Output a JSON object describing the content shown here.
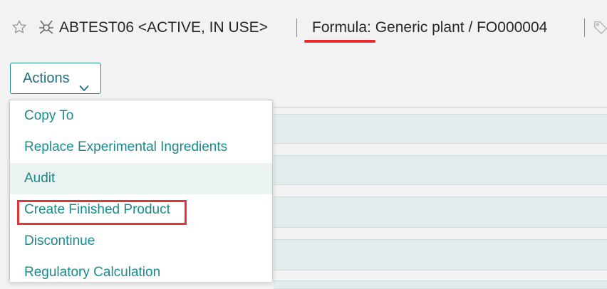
{
  "header": {
    "record_title": "ABTEST06 <ACTIVE, IN USE>",
    "formula_key": "Formula",
    "formula_value": ": Generic plant / FO000004",
    "icons": [
      "star-icon",
      "node-icon",
      "tag-icon"
    ]
  },
  "actions": {
    "label": "Actions",
    "icon": "chevron-down-icon"
  },
  "menu": {
    "items": [
      {
        "label": "Copy To"
      },
      {
        "label": "Replace Experimental Ingredients"
      },
      {
        "label": "Audit",
        "highlighted": true
      },
      {
        "label": "Create Finished Product",
        "annotated": true
      },
      {
        "label": "Discontinue"
      },
      {
        "label": "Regulatory Calculation"
      }
    ]
  },
  "colors": {
    "accent_teal": "#1a8a8c",
    "annotation_red": "#e0363a",
    "row_tint": "#e3ebec"
  }
}
